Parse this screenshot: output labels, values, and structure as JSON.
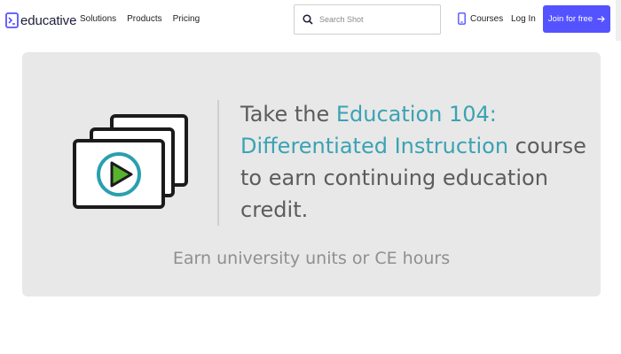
{
  "header": {
    "logo_text": "educative",
    "nav": [
      "Solutions",
      "Products",
      "Pricing"
    ],
    "search": {
      "placeholder": "Search Shot",
      "value": ""
    },
    "courses_label": "Courses",
    "login_label": "Log In",
    "join_label": "Join for free"
  },
  "banner": {
    "headline_prefix": "Take the ",
    "course_title_line1": "Education 104:",
    "course_title_line2": "Differentiated Instruction",
    "headline_suffix": " course to earn continuing education credit.",
    "subline": "Earn university units or CE hours"
  },
  "colors": {
    "brand": "#5553ff",
    "accent": "#3aa3b3",
    "banner_bg": "#e8e8e8",
    "play_ring": "#2a9fb0",
    "play_triangle": "#57b22e"
  },
  "icons": {
    "logo": "educative-logo-icon",
    "search": "search-icon",
    "courses": "device-icon",
    "join": "arrow-right-icon",
    "banner": "video-stack-play-icon"
  }
}
